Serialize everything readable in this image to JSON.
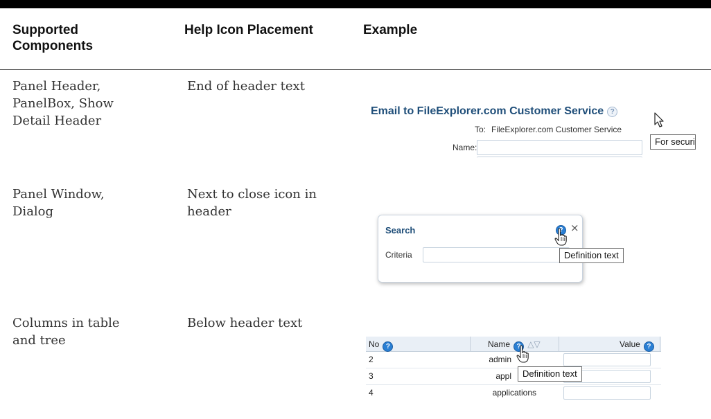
{
  "table": {
    "headers": {
      "components": "Supported Components",
      "placement": "Help Icon Placement",
      "example": "Example"
    },
    "rows": [
      {
        "components": "Panel Header, PanelBox, Show Detail Header",
        "placement": "End of header text"
      },
      {
        "components": "Panel Window, Dialog",
        "placement": "Next to close icon in header"
      },
      {
        "components": "Columns in table and tree",
        "placement": "Below header text"
      }
    ]
  },
  "example1": {
    "title": "Email to FileExplorer.com Customer Service",
    "to_label": "To:",
    "to_value": "FileExplorer.com Customer Service",
    "name_label": "Name:",
    "tooltip": "For securi"
  },
  "example2": {
    "title": "Search",
    "close": "×",
    "criteria_label": "Criteria",
    "tooltip": "Definition text"
  },
  "example3": {
    "columns": [
      "No",
      "Name",
      "Value"
    ],
    "sort_icons": "△▽",
    "rows": [
      {
        "no": "2",
        "name": "admin"
      },
      {
        "no": "3",
        "name": "appl"
      },
      {
        "no": "4",
        "name": "applications"
      }
    ],
    "tooltip": "Definition text"
  },
  "help_icon_glyph": "?",
  "colors": {
    "title_blue": "#1f4e79",
    "help_blue": "#2a7fd4",
    "table_header_bg": "#e9eff6"
  }
}
